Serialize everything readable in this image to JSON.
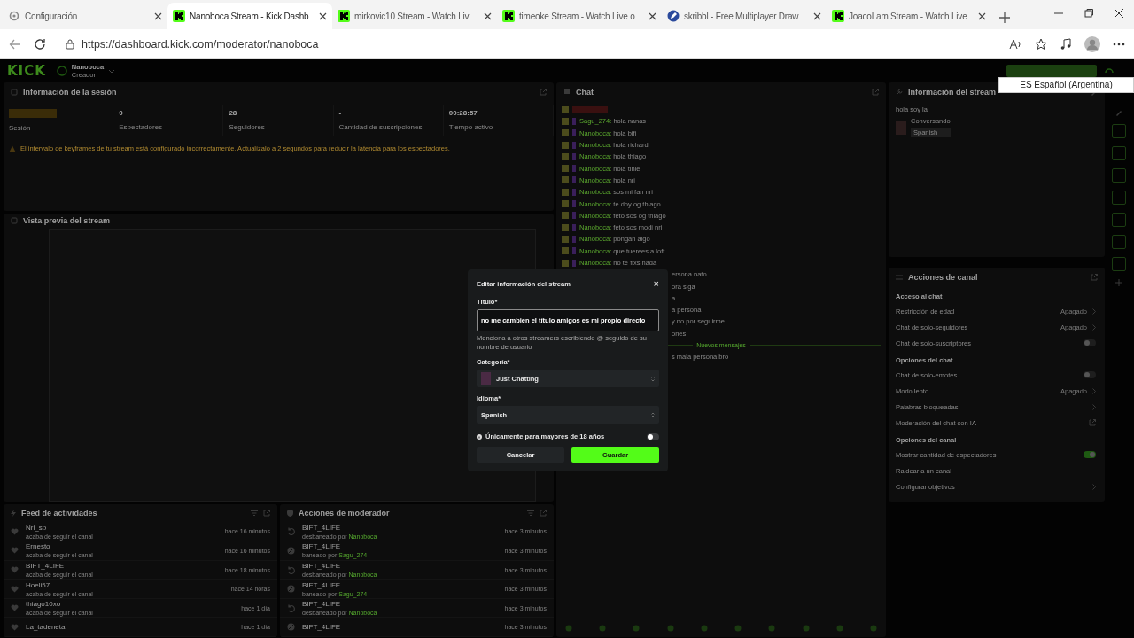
{
  "browser": {
    "tabs": [
      {
        "title": "Configuración",
        "kind": "settings",
        "selected": false
      },
      {
        "title": "Nanoboca Stream - Kick Dashb",
        "kind": "kick",
        "selected": true
      },
      {
        "title": "mirkovic10 Stream - Watch Liv",
        "kind": "kick",
        "selected": false
      },
      {
        "title": "timeoke Stream - Watch Live o",
        "kind": "kick",
        "selected": false
      },
      {
        "title": "skribbl - Free Multiplayer Draw",
        "kind": "game",
        "selected": false
      },
      {
        "title": "JoacoLam Stream - Watch Live",
        "kind": "kick",
        "selected": false
      }
    ],
    "url": "https://dashboard.kick.com/moderator/nanoboca"
  },
  "dashboard": {
    "logo": "KICK",
    "channel": {
      "name": "Nanoboca",
      "role": "Creador"
    },
    "session": {
      "title": "Información de la sesión",
      "stats": [
        {
          "kind": "badge",
          "label": "Sesión"
        },
        {
          "kind": "number",
          "value": "0",
          "label": "Espectadores"
        },
        {
          "kind": "number",
          "value": "28",
          "label": "Seguidores"
        },
        {
          "kind": "number",
          "value": "-",
          "label": "Cantidad de suscripciones"
        },
        {
          "kind": "number",
          "value": "00:28:57",
          "label": "Tiempo activo"
        }
      ],
      "warning": "El intervalo de keyframes de tu stream está configurado incorrectamente. Actualízalo a 2 segundos para reducir la latencia para los espectadores."
    },
    "preview": {
      "title": "Vista previa del stream"
    },
    "activity_feed": {
      "title": "Feed de actividades",
      "rows": [
        {
          "user": "Nri_sp",
          "text": "acaba de seguir el canal",
          "time": "hace 16 minutos"
        },
        {
          "user": "Ernesto",
          "text": "acaba de seguir el canal",
          "time": "hace 16 minutos"
        },
        {
          "user": "BIFT_4LIFE",
          "text": "acaba de seguir el canal",
          "time": "hace 18 minutos"
        },
        {
          "user": "Hoeli57",
          "text": "acaba de seguir el canal",
          "time": "hace 14 horas"
        },
        {
          "user": "thiago10xo",
          "text": "acaba de seguir el canal",
          "time": "hace 1 día"
        },
        {
          "user": "La_tadeneta",
          "text": "",
          "time": "hace 1 día"
        }
      ]
    },
    "mod_actions": {
      "title": "Acciones de moderador",
      "rows": [
        {
          "kind": "unban",
          "user": "BIFT_4LIFE",
          "action": "desbaneado por",
          "by": "Nanoboca",
          "time": "hace 3 minutos"
        },
        {
          "kind": "ban",
          "user": "BIFT_4LIFE",
          "action": "baneado por",
          "by": "Sagu_274",
          "time": "hace 3 minutos"
        },
        {
          "kind": "unban",
          "user": "BIFT_4LIFE",
          "action": "desbaneado por",
          "by": "Nanoboca",
          "time": "hace 3 minutos"
        },
        {
          "kind": "ban",
          "user": "BIFT_4LIFE",
          "action": "baneado por",
          "by": "Sagu_274",
          "time": "hace 3 minutos"
        },
        {
          "kind": "unban",
          "user": "BIFT_4LIFE",
          "action": "desbaneado por",
          "by": "Nanoboca",
          "time": "hace 3 minutos"
        },
        {
          "kind": "ban",
          "user": "BIFT_4LIFE",
          "action": "",
          "by": "",
          "time": "hace 3 minutos"
        }
      ]
    },
    "chat": {
      "title": "Chat",
      "messages": [
        {
          "kind": "message",
          "user": "Sagu_274:",
          "text": "hola nanas"
        },
        {
          "kind": "message",
          "user": "Nanoboca:",
          "text": "hola bifi"
        },
        {
          "kind": "message",
          "user": "Nanoboca:",
          "text": "hola richard"
        },
        {
          "kind": "message",
          "user": "Nanoboca:",
          "text": "hola thiago"
        },
        {
          "kind": "message",
          "user": "Nanoboca:",
          "text": "hola tinie"
        },
        {
          "kind": "message",
          "user": "Nanoboca:",
          "text": "hola nri"
        },
        {
          "kind": "message",
          "user": "Nanoboca:",
          "text": "sos mi fan nri"
        },
        {
          "kind": "message",
          "user": "Nanoboca:",
          "text": "te doy og thiago"
        },
        {
          "kind": "message",
          "user": "Nanoboca:",
          "text": "feto sos og thiago"
        },
        {
          "kind": "message",
          "user": "Nanoboca:",
          "text": "feto sos modi nri"
        },
        {
          "kind": "message",
          "user": "Nanoboca:",
          "text": "pongan algo"
        },
        {
          "kind": "message",
          "user": "Nanoboca:",
          "text": "que tuerees a loft"
        },
        {
          "kind": "message",
          "user": "Nanoboca:",
          "text": "no te fixs nada"
        },
        {
          "kind": "fragment",
          "text": "ersona nato"
        },
        {
          "kind": "fragment",
          "text": "ora siga"
        },
        {
          "kind": "fragment",
          "text": "a"
        },
        {
          "kind": "fragment",
          "text": "a persona"
        },
        {
          "kind": "fragment",
          "text": "y no por seguirme"
        },
        {
          "kind": "fragment",
          "text": "ones"
        },
        {
          "kind": "divider",
          "text": "Nuevos mensajes"
        },
        {
          "kind": "fragment",
          "text": "s mala persona bro"
        }
      ]
    },
    "stream_info": {
      "title": "Información del stream",
      "stream_title": "hola soy la",
      "category": "Conversando",
      "language": "Spanish"
    },
    "channel_actions": {
      "title": "Acciones de canal",
      "sections": [
        {
          "heading": "Acceso al chat",
          "items": [
            {
              "kind": "link",
              "label": "Restricción de edad",
              "value": "Apagado"
            },
            {
              "kind": "link",
              "label": "Chat de solo-seguidores",
              "value": "Apagado"
            },
            {
              "kind": "toggle",
              "label": "Chat de solo-suscriptores",
              "on": false
            }
          ]
        },
        {
          "heading": "Opciones del chat",
          "items": [
            {
              "kind": "toggle",
              "label": "Chat de solo-emotes",
              "on": false
            },
            {
              "kind": "link",
              "label": "Modo lento",
              "value": "Apagado"
            },
            {
              "kind": "link",
              "label": "Palabras bloqueadas",
              "value": ""
            },
            {
              "kind": "external",
              "label": "Moderación del chat con IA"
            }
          ]
        },
        {
          "heading": "Opciones del canal",
          "items": [
            {
              "kind": "toggle",
              "label": "Mostrar cantidad de espectadores",
              "on": true
            },
            {
              "kind": "plain",
              "label": "Raidear a un canal"
            },
            {
              "kind": "link",
              "label": "Configurar objetivos",
              "value": ""
            }
          ]
        }
      ]
    }
  },
  "language_popup": {
    "text": "ES Español (Argentina)"
  },
  "modal": {
    "title": "Editar información del stream",
    "close": "×",
    "fields": [
      {
        "kind": "text",
        "label": "Título*",
        "value": "no me cambien el título amigos es mi propio directo",
        "hint": "Menciona a otros streamers escribiendo @ seguido de su nombre de usuario"
      },
      {
        "kind": "category",
        "label": "Categoría*",
        "value": "Just Chatting"
      },
      {
        "kind": "select",
        "label": "Idioma*",
        "value": "Spanish"
      }
    ],
    "adult_only": {
      "label": "Únicamente para mayores de 18 años",
      "on": false
    },
    "buttons": [
      {
        "kind": "secondary",
        "label": "Cancelar"
      },
      {
        "kind": "primary",
        "label": "Guardar"
      }
    ]
  }
}
